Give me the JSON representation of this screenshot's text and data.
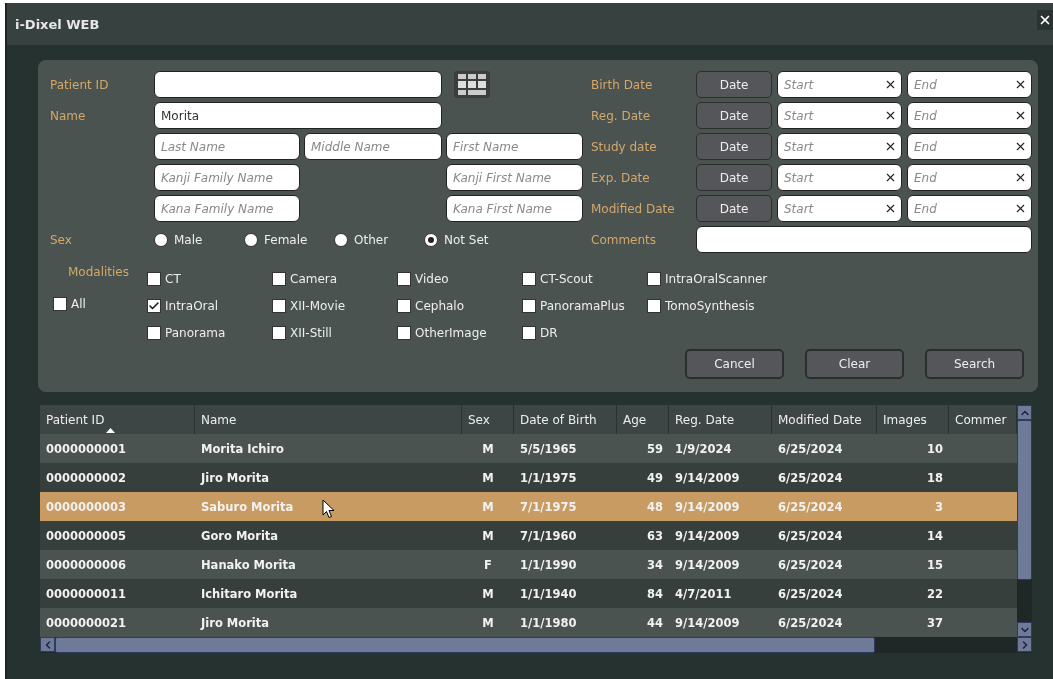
{
  "window": {
    "title": "i-Dixel WEB"
  },
  "search_form": {
    "patient_id": {
      "label": "Patient ID"
    },
    "name": {
      "label": "Name",
      "value": "Morita"
    },
    "name_parts": [
      {
        "placeholder": "Last Name"
      },
      {
        "placeholder": "Middle Name"
      },
      {
        "placeholder": "First Name"
      }
    ],
    "kanji_parts": [
      {
        "placeholder": "Kanji Family Name"
      },
      {
        "placeholder": "Kanji First Name"
      }
    ],
    "kana_parts": [
      {
        "placeholder": "Kana Family Name"
      },
      {
        "placeholder": "Kana First Name"
      }
    ],
    "sex": {
      "label": "Sex",
      "options": [
        {
          "label": "Male",
          "selected": false
        },
        {
          "label": "Female",
          "selected": false
        },
        {
          "label": "Other",
          "selected": false
        },
        {
          "label": "Not Set",
          "selected": true
        }
      ]
    },
    "date_filters": [
      {
        "label": "Birth Date",
        "button": "Date",
        "start": {
          "placeholder": "Start"
        },
        "end": {
          "placeholder": "End"
        }
      },
      {
        "label": "Reg. Date",
        "button": "Date",
        "start": {
          "placeholder": "Start"
        },
        "end": {
          "placeholder": "End"
        }
      },
      {
        "label": "Study date",
        "button": "Date",
        "start": {
          "placeholder": "Start"
        },
        "end": {
          "placeholder": "End"
        }
      },
      {
        "label": "Exp. Date",
        "button": "Date",
        "start": {
          "placeholder": "Start"
        },
        "end": {
          "placeholder": "End"
        }
      },
      {
        "label": "Modified Date",
        "button": "Date",
        "start": {
          "placeholder": "Start"
        },
        "end": {
          "placeholder": "End"
        }
      }
    ],
    "comments": {
      "label": "Comments"
    },
    "modalities": {
      "label": "Modalities",
      "all": {
        "label": "All",
        "checked": false
      },
      "items": [
        {
          "label": "CT",
          "checked": false
        },
        {
          "label": "Camera",
          "checked": false
        },
        {
          "label": "Video",
          "checked": false
        },
        {
          "label": "CT-Scout",
          "checked": false
        },
        {
          "label": "IntraOralScanner",
          "checked": false
        },
        {
          "label": "IntraOral",
          "checked": true
        },
        {
          "label": "XII-Movie",
          "checked": false
        },
        {
          "label": "Cephalo",
          "checked": false
        },
        {
          "label": "PanoramaPlus",
          "checked": false
        },
        {
          "label": "TomoSynthesis",
          "checked": false
        },
        {
          "label": "Panorama",
          "checked": false
        },
        {
          "label": "XII-Still",
          "checked": false
        },
        {
          "label": "OtherImage",
          "checked": false
        },
        {
          "label": "DR",
          "checked": false
        }
      ]
    },
    "buttons": [
      "Cancel",
      "Clear",
      "Search"
    ]
  },
  "table": {
    "columns": [
      {
        "label": "Patient ID",
        "sorted": true
      },
      {
        "label": "Name",
        "sorted": false
      },
      {
        "label": "Sex",
        "sorted": false
      },
      {
        "label": "Date of Birth",
        "sorted": false
      },
      {
        "label": "Age",
        "sorted": false
      },
      {
        "label": "Reg. Date",
        "sorted": false
      },
      {
        "label": "Modified Date",
        "sorted": false
      },
      {
        "label": "Images",
        "sorted": false
      },
      {
        "label": "Commer",
        "sorted": false
      }
    ],
    "rows": [
      {
        "cells": [
          "0000000001",
          "Morita Ichiro",
          "M",
          "5/5/1965",
          "59",
          "1/9/2024",
          "6/25/2024",
          "10"
        ],
        "selected": false
      },
      {
        "cells": [
          "0000000002",
          "Jiro Morita",
          "M",
          "1/1/1975",
          "49",
          "9/14/2009",
          "6/25/2024",
          "18"
        ],
        "selected": false
      },
      {
        "cells": [
          "0000000003",
          "Saburo Morita",
          "M",
          "7/1/1975",
          "48",
          "9/14/2009",
          "6/25/2024",
          "3"
        ],
        "selected": true
      },
      {
        "cells": [
          "0000000005",
          "Goro Morita",
          "M",
          "7/1/1960",
          "63",
          "9/14/2009",
          "6/25/2024",
          "14"
        ],
        "selected": false
      },
      {
        "cells": [
          "0000000006",
          "Hanako Morita",
          "F",
          "1/1/1990",
          "34",
          "9/14/2009",
          "6/25/2024",
          "15"
        ],
        "selected": false
      },
      {
        "cells": [
          "0000000011",
          "Ichitaro Morita",
          "M",
          "1/1/1940",
          "84",
          "4/7/2011",
          "6/25/2024",
          "22"
        ],
        "selected": false
      },
      {
        "cells": [
          "0000000021",
          "Jiro Morita",
          "M",
          "1/1/1980",
          "44",
          "9/14/2009",
          "6/25/2024",
          "37"
        ],
        "selected": false
      }
    ]
  }
}
